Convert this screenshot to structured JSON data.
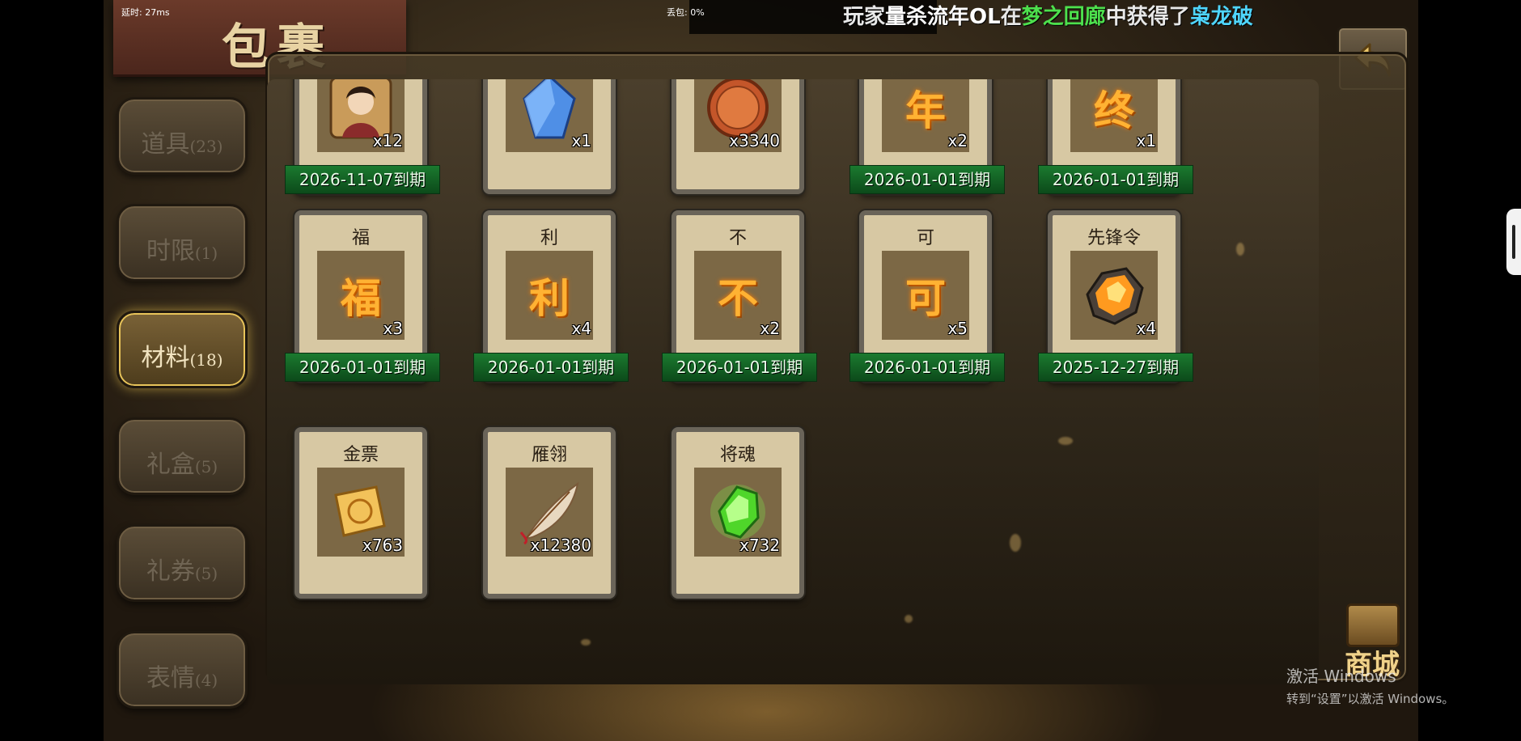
{
  "header": {
    "title": "包裹"
  },
  "network": {
    "latency": "延时: 27ms",
    "packet_loss": "丢包: 0%"
  },
  "broadcast": {
    "segments": [
      {
        "text": "玩家",
        "color": "#e8e8e8"
      },
      {
        "text": "量杀流年OL",
        "color": "#ffffff"
      },
      {
        "text": "在",
        "color": "#e8e8e8"
      },
      {
        "text": "梦之回廊",
        "color": "#4de04d"
      },
      {
        "text": "中获得了",
        "color": "#e8e8e8"
      },
      {
        "text": "枭龙破",
        "color": "#4fd6ff"
      }
    ]
  },
  "tabs": [
    {
      "label": "道具",
      "count": "(23)",
      "active": false
    },
    {
      "label": "时限",
      "count": "(1)",
      "active": false
    },
    {
      "label": "材料",
      "count": "(18)",
      "active": true
    },
    {
      "label": "礼盒",
      "count": "(5)",
      "active": false
    },
    {
      "label": "礼券",
      "count": "(5)",
      "active": false
    },
    {
      "label": "表情",
      "count": "(4)",
      "active": false
    }
  ],
  "items": [
    {
      "name": "",
      "glyph": "",
      "icon": "character-portrait-icon",
      "qty": "x12",
      "expiry": "2026-11-07到期"
    },
    {
      "name": "",
      "glyph": "",
      "icon": "blue-crystal-icon",
      "qty": "x1",
      "expiry": ""
    },
    {
      "name": "",
      "glyph": "",
      "icon": "bronze-coin-icon",
      "qty": "x3340",
      "expiry": ""
    },
    {
      "name": "",
      "glyph": "年",
      "icon": "glyph-icon",
      "qty": "x2",
      "expiry": "2026-01-01到期"
    },
    {
      "name": "",
      "glyph": "终",
      "icon": "glyph-icon",
      "qty": "x1",
      "expiry": "2026-01-01到期"
    },
    {
      "name": "福",
      "glyph": "福",
      "icon": "glyph-icon",
      "qty": "x3",
      "expiry": "2026-01-01到期"
    },
    {
      "name": "利",
      "glyph": "利",
      "icon": "glyph-icon",
      "qty": "x4",
      "expiry": "2026-01-01到期"
    },
    {
      "name": "不",
      "glyph": "不",
      "icon": "glyph-icon",
      "qty": "x2",
      "expiry": "2026-01-01到期"
    },
    {
      "name": "可",
      "glyph": "可",
      "icon": "glyph-icon",
      "qty": "x5",
      "expiry": "2026-01-01到期"
    },
    {
      "name": "先锋令",
      "glyph": "",
      "icon": "amber-gem-icon",
      "qty": "x4",
      "expiry": "2025-12-27到期"
    },
    {
      "name": "金票",
      "glyph": "",
      "icon": "gold-scroll-icon",
      "qty": "x763",
      "expiry": ""
    },
    {
      "name": "雁翎",
      "glyph": "",
      "icon": "feather-icon",
      "qty": "x12380",
      "expiry": ""
    },
    {
      "name": "将魂",
      "glyph": "",
      "icon": "green-crystal-icon",
      "qty": "x732",
      "expiry": ""
    }
  ],
  "shop": {
    "label": "商城"
  },
  "watermark": {
    "title": "激活 Windows",
    "subtitle": "转到“设置”以激活 Windows。"
  }
}
